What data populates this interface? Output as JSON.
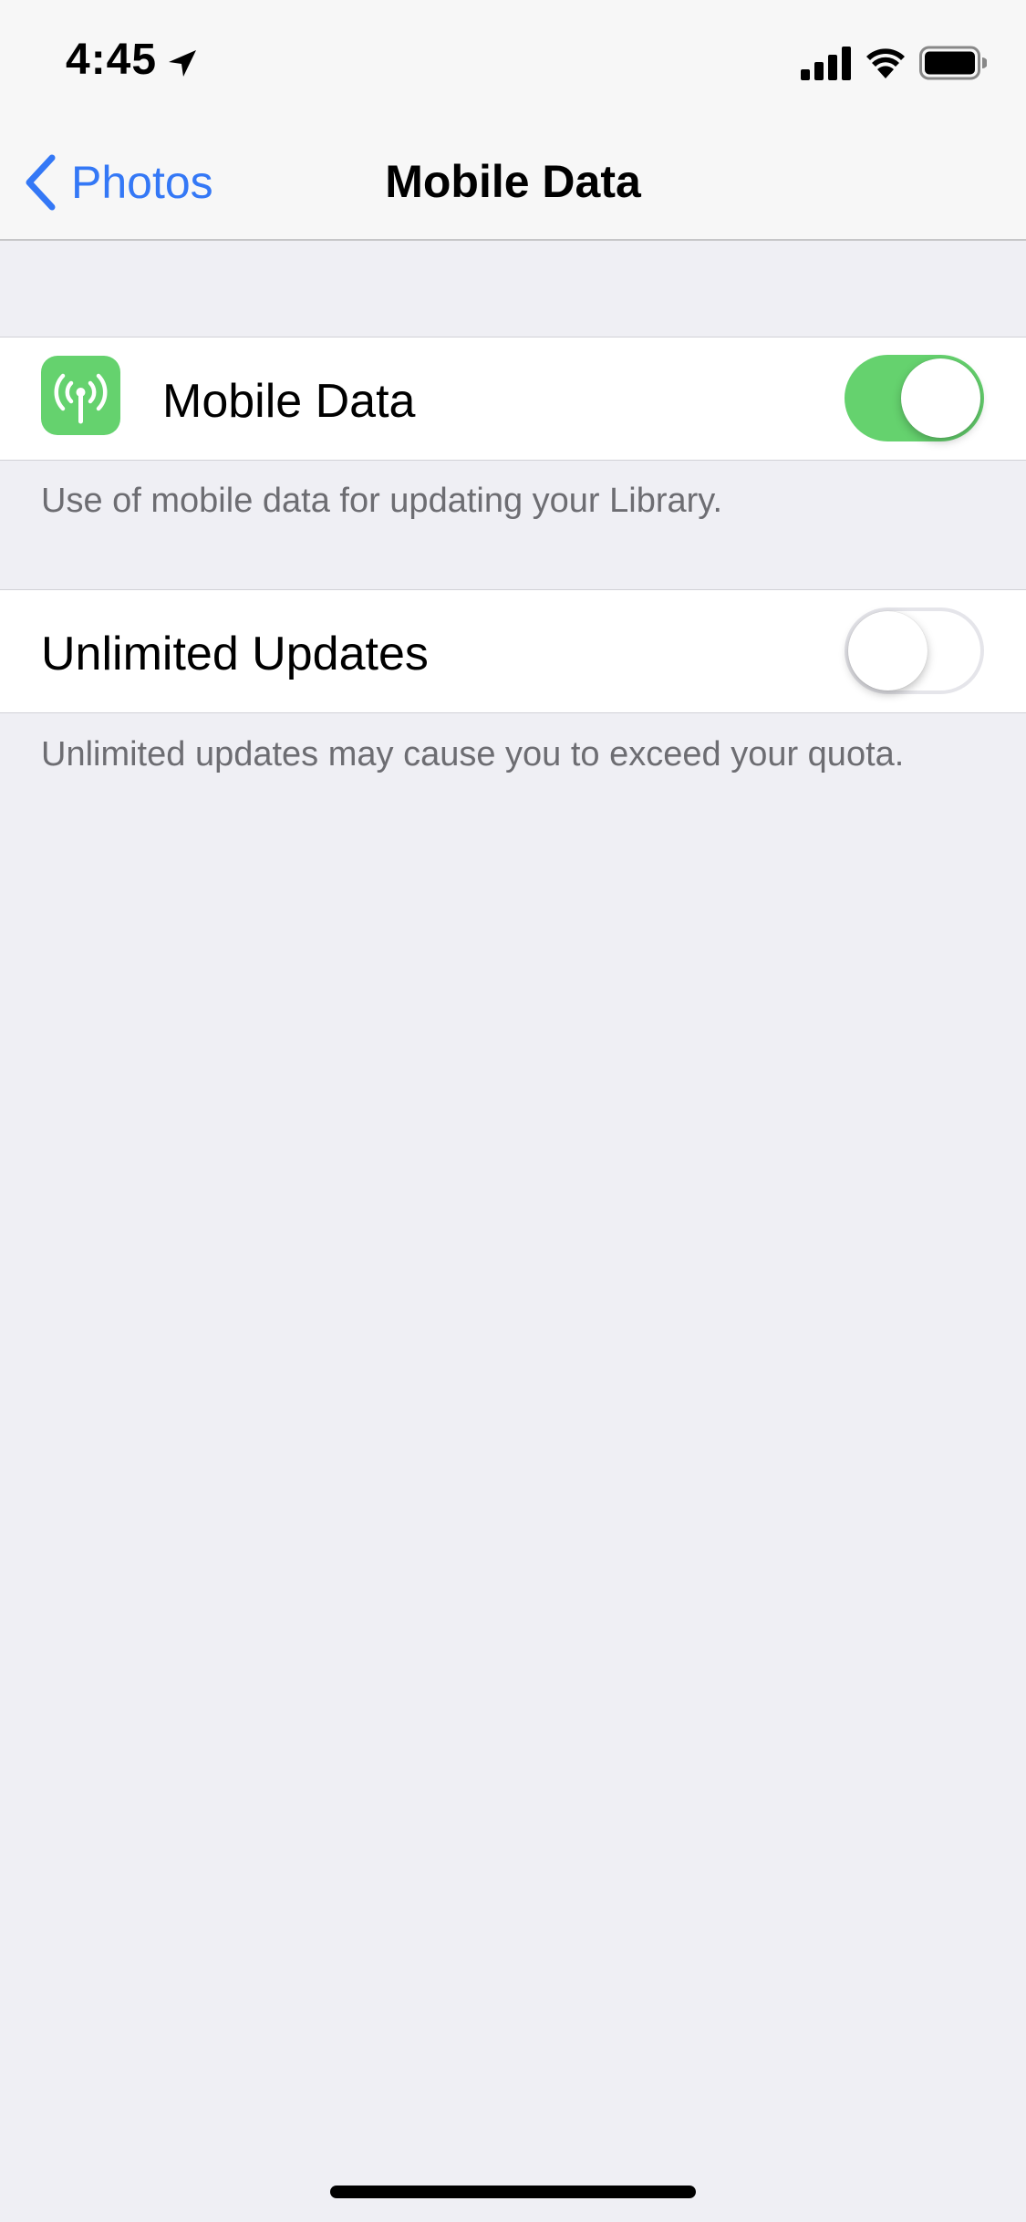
{
  "status_bar": {
    "time": "4:45",
    "icons": [
      "location-arrow-icon",
      "cellular-signal-icon",
      "wifi-icon",
      "battery-icon"
    ]
  },
  "nav": {
    "back_label": "Photos",
    "title": "Mobile Data"
  },
  "settings": {
    "mobile_data": {
      "label": "Mobile Data",
      "icon": "antenna-icon",
      "icon_color": "#65d26e",
      "enabled": true,
      "footer": "Use of mobile data for updating your Library."
    },
    "unlimited_updates": {
      "label": "Unlimited Updates",
      "enabled": false,
      "footer": "Unlimited updates may cause you to exceed your quota."
    }
  },
  "colors": {
    "accent": "#3478f6",
    "toggle_on": "#65d26e",
    "background": "#efeff4",
    "footer_text": "#6d6d72"
  }
}
